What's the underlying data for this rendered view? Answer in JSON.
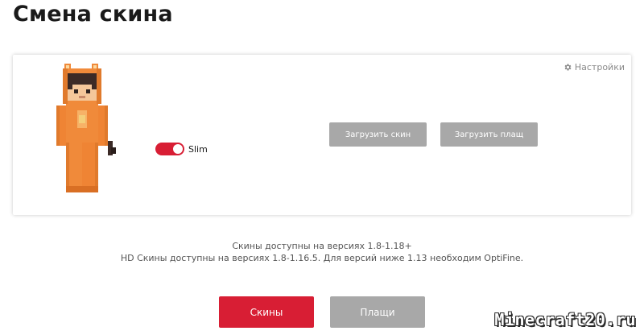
{
  "header": {
    "title": "Смена скина"
  },
  "skin_card": {
    "settings_label": "Настройки",
    "settings_icon": "gear-icon",
    "slim_toggle": {
      "label": "Slim",
      "enabled": true
    },
    "upload_skin_label": "Загрузить скин",
    "upload_cape_label": "Загрузить плащ"
  },
  "info": {
    "line1": "Скины доступны на версиях 1.8-1.18+",
    "line2": "HD Скины доступны на версиях 1.8-1.16.5. Для версий ниже 1.13 необходим OptiFine."
  },
  "tabs": {
    "skins_label": "Скины",
    "capes_label": "Плащи"
  },
  "watermark": {
    "text": "Minecraft20.ru"
  },
  "colors": {
    "accent_red": "#d81e34",
    "button_gray": "#a8a8a8",
    "skin_orange": "#f08a3a"
  }
}
